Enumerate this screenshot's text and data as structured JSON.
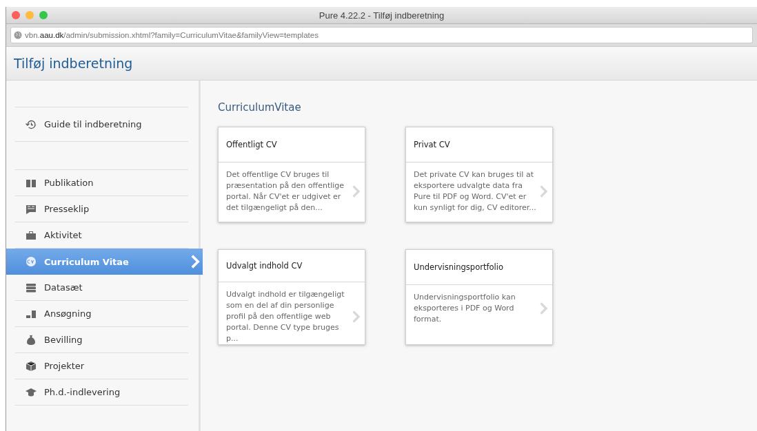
{
  "window": {
    "title": "Pure 4.22.2 - Tilføj indberetning"
  },
  "address_bar": {
    "url": "vbn.**aau.dk**/admin/submission.xhtml?family=CurriculumVitae&familyView=templates"
  },
  "page_title": "Tilføj indberetning",
  "sidebar": {
    "guide": {
      "label": "Guide til indberetning"
    },
    "items": [
      {
        "label": "Publikation",
        "selected": false
      },
      {
        "label": "Presseklip",
        "selected": false
      },
      {
        "label": "Aktivitet",
        "selected": false
      },
      {
        "label": "Curriculum Vitae",
        "selected": true
      },
      {
        "label": "Datasæt",
        "selected": false
      },
      {
        "label": "Ansøgning",
        "selected": false
      },
      {
        "label": "Bevilling",
        "selected": false
      },
      {
        "label": "Projekter",
        "selected": false
      },
      {
        "label": "Ph.d.-indlevering",
        "selected": false
      }
    ]
  },
  "section_title": "CurriculumVitae",
  "templates": [
    {
      "title": "Offentligt CV",
      "description": "Det offentlige CV bruges til præsentation på den offentlige portal. Når CV'et er udgivet er det tilgængeligt på den..."
    },
    {
      "title": "Privat CV",
      "description": "Det private CV kan bruges til at eksportere udvalgte data fra Pure til PDF og Word. CV'et er kun synligt for dig, CV editorer..."
    },
    {
      "title": "Udvalgt indhold CV",
      "description": "Udvalgt indhold er tilgængeligt som en del af din personlige profil på den offentlige web portal. Denne CV type bruges p..."
    },
    {
      "title": "Undervisningsportfolio",
      "description": "Undervisningsportfolio kan eksporteres i PDF og Word format."
    }
  ]
}
